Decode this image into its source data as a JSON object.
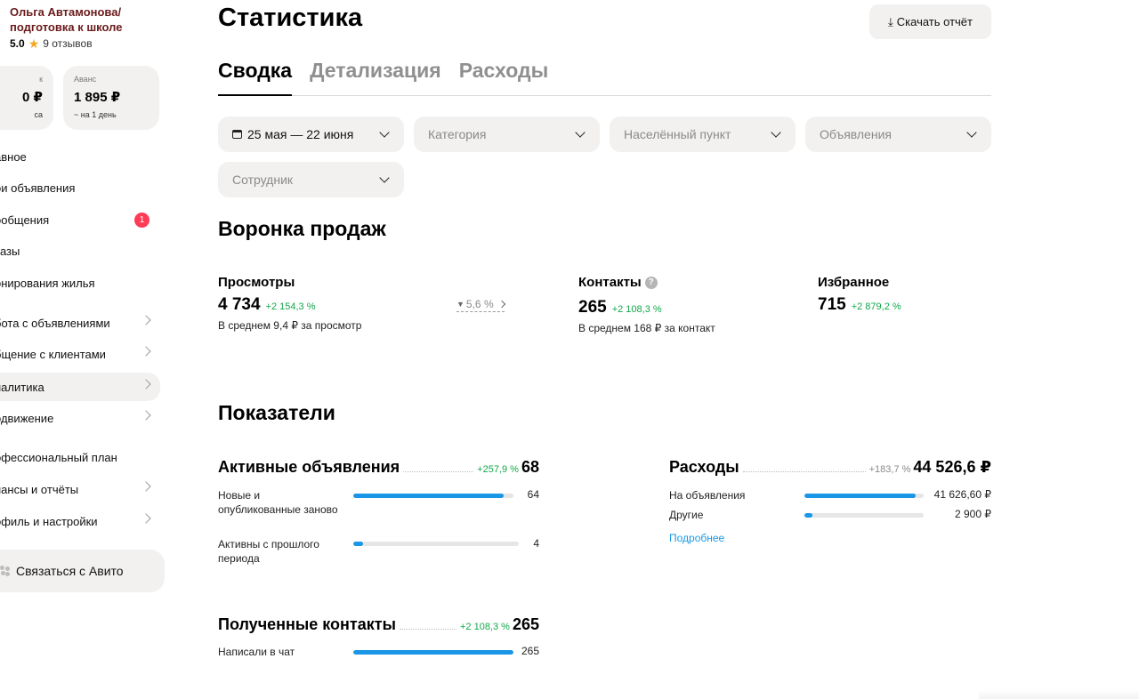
{
  "sidebar": {
    "profile_name": "Ольга Автамонова/ подготовка к школе",
    "rating": "5.0",
    "star_icon": "star-icon",
    "reviews": "9 отзывов",
    "cards": [
      {
        "label": "к",
        "amount": "0 ₽",
        "sub": "са"
      },
      {
        "label": "Аванс",
        "amount": "1 895 ₽",
        "sub": "~ на 1 день"
      }
    ],
    "nav": [
      {
        "label": "авное"
      },
      {
        "label": "ои объявления"
      },
      {
        "label": "ообщения",
        "badge": "1"
      },
      {
        "label": "казы"
      },
      {
        "label": "онирования жилья"
      },
      {
        "label": "бота с объявлениями"
      },
      {
        "label": "бщение с клиентами"
      },
      {
        "label": "налитика"
      },
      {
        "label": "одвижение"
      },
      {
        "label": "офессиональный план"
      },
      {
        "label": "нансы и отчёты"
      },
      {
        "label": "офиль и настройки"
      }
    ],
    "contact_button": "Связаться с Авито"
  },
  "header": {
    "title": "Статистика",
    "download_label": "Скачать отчёт"
  },
  "tabs": [
    {
      "label": "Сводка"
    },
    {
      "label": "Детализация"
    },
    {
      "label": "Расходы"
    }
  ],
  "filters": {
    "date": "25 мая — 22 июня",
    "category": "Категория",
    "locality": "Населённый пункт",
    "ads": "Объявления",
    "employee": "Сотрудник"
  },
  "funnel": {
    "title": "Воронка продаж",
    "views": {
      "label": "Просмотры",
      "value": "4 734",
      "delta": "+2 154,3 %",
      "avg": "В среднем 9,4 ₽ за просмотр"
    },
    "conversion": "5,6 %",
    "contacts": {
      "label": "Контакты",
      "value": "265",
      "delta": "+2 108,3 %",
      "avg": "В среднем 168 ₽ за контакт"
    },
    "favorites": {
      "label": "Избранное",
      "value": "715",
      "delta": "+2 879,2 %"
    }
  },
  "indicators": {
    "title": "Показатели",
    "active_ads": {
      "name": "Активные объявления",
      "delta": "+257,9 %",
      "total": "68",
      "rows": [
        {
          "label": "Новые и опубликованные заново",
          "value": "64",
          "fill": 0.94
        },
        {
          "label": "Активны с прошлого периода",
          "value": "4",
          "fill": 0.06
        }
      ]
    },
    "expenses": {
      "name": "Расходы",
      "delta": "+183,7 %",
      "total": "44 526,6 ₽",
      "rows": [
        {
          "label": "На объявления",
          "value": "41 626,60 ₽",
          "fill": 0.93
        },
        {
          "label": "Другие",
          "value": "2 900 ₽",
          "fill": 0.07
        }
      ],
      "more_link": "Подробнее"
    },
    "received_contacts": {
      "name": "Полученные контакты",
      "delta": "+2 108,3 %",
      "total": "265",
      "rows": [
        {
          "label": "Написали в чат",
          "value": "265",
          "fill": 1.0
        }
      ]
    }
  },
  "colors": {
    "accent_bar": "#1996e6",
    "positive": "#12a84a",
    "badge": "#ff3b57",
    "link": "#1a9ae6"
  }
}
